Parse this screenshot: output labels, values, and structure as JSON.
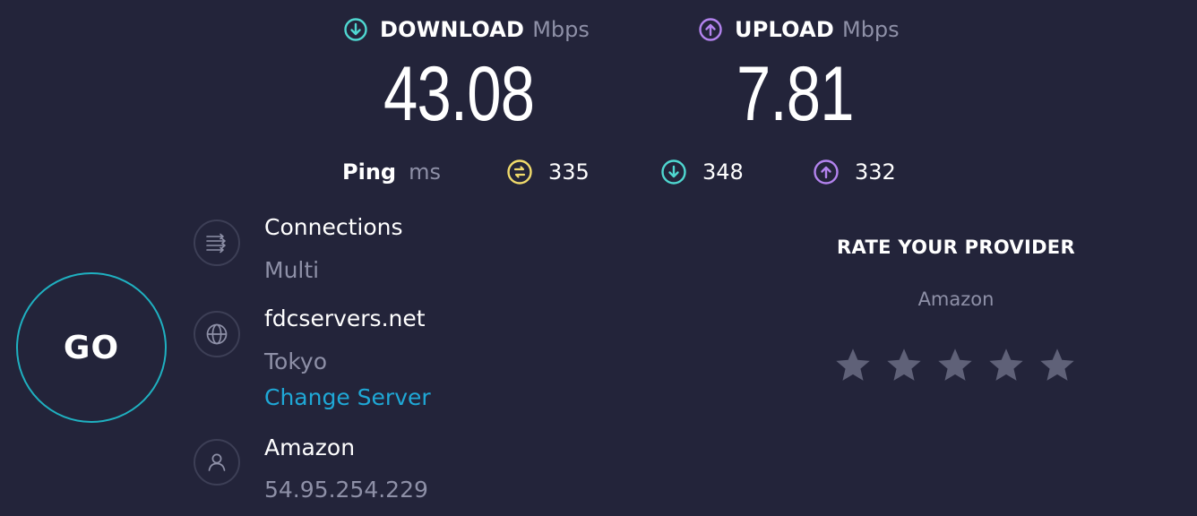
{
  "download": {
    "label": "DOWNLOAD",
    "unit": "Mbps",
    "value": "43.08",
    "icon": "download-arrow-icon",
    "color": "#4fd7d0"
  },
  "upload": {
    "label": "UPLOAD",
    "unit": "Mbps",
    "value": "7.81",
    "icon": "upload-arrow-icon",
    "color": "#b383ee"
  },
  "ping": {
    "label": "Ping",
    "unit": "ms",
    "idle": {
      "value": "335",
      "icon": "idle-latency-icon",
      "color": "#f1db6b"
    },
    "download": {
      "value": "348",
      "icon": "download-latency-icon",
      "color": "#4fd7d0"
    },
    "upload": {
      "value": "332",
      "icon": "upload-latency-icon",
      "color": "#b383ee"
    }
  },
  "go": {
    "label": "GO",
    "color": "#1fb1c1"
  },
  "connections": {
    "title": "Connections",
    "value": "Multi",
    "icon": "connections-icon"
  },
  "server": {
    "name": "fdcservers.net",
    "location": "Tokyo",
    "change_label": "Change Server",
    "icon": "globe-icon"
  },
  "provider": {
    "name": "Amazon",
    "ip": "54.95.254.229",
    "icon": "user-icon"
  },
  "rating": {
    "title": "RATE YOUR PROVIDER",
    "provider": "Amazon",
    "stars_total": 5,
    "stars_selected": 0,
    "icon": "star-icon"
  },
  "colors": {
    "background": "#23243a",
    "muted_text": "#8e90a7",
    "link": "#1fa8d6",
    "star": "#5f6178"
  }
}
